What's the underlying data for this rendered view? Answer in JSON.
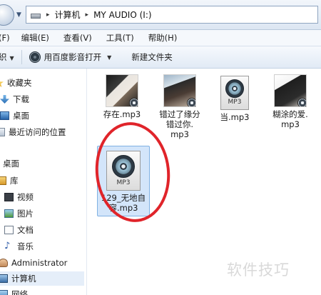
{
  "address": {
    "separator": "▸",
    "computer": "计算机",
    "drive": "MY AUDIO (I:)"
  },
  "menu": [
    "(F)",
    "编辑(E)",
    "查看(V)",
    "工具(T)",
    "帮助(H)"
  ],
  "toolbar": {
    "organize": "织",
    "open_with": "用百度影音打开",
    "new_folder": "新建文件夹"
  },
  "sidebar": {
    "favorites": "收藏夹",
    "downloads": "下载",
    "desktop_fav": "桌面",
    "recent": "最近访问的位置",
    "desktop": "桌面",
    "library": "库",
    "video": "视频",
    "pictures": "图片",
    "documents": "文档",
    "music": "音乐",
    "administrator": "Administrator",
    "computer": "计算机",
    "network": "网络"
  },
  "files": [
    {
      "name": "存在.mp3",
      "type": "photo"
    },
    {
      "name": "错过了缘分错过你.mp3",
      "type": "photo"
    },
    {
      "name": "当.mp3",
      "type": "mp3"
    },
    {
      "name": "糊涂的爱.mp3",
      "type": "photo"
    },
    {
      "name": "129_无地自容.mp3",
      "type": "mp3",
      "selected": true
    }
  ],
  "file_labels": {
    "f1": "存在.mp3",
    "f2_line1": "错过了缘分",
    "f2_line2": "错过你.",
    "f2_line3": "mp3",
    "f3": "当.mp3",
    "f4_line1": "糊涂的爱.",
    "f4_line2": "mp3",
    "f5_line1": "129_无地自",
    "f5_line2": "容.mp3"
  },
  "mp3_badge": "MP3",
  "watermark": "软件技巧",
  "colors": {
    "highlight_circle": "#e0242a",
    "selection": "#d3e5fa"
  }
}
